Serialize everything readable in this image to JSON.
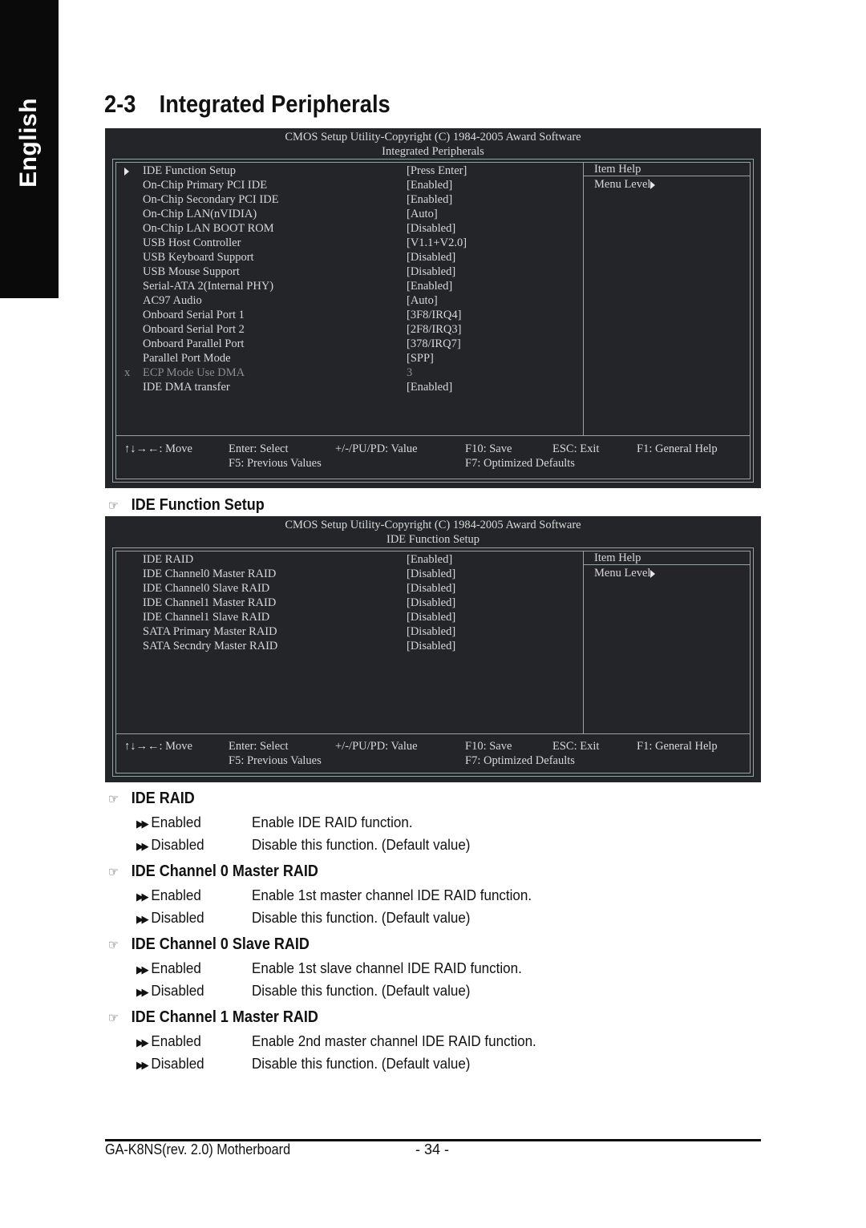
{
  "sidebar_tab": "English",
  "page_title": {
    "number": "2-3",
    "text": "Integrated Peripherals"
  },
  "bios_screens": [
    {
      "header_line1": "CMOS Setup Utility-Copyright (C) 1984-2005 Award Software",
      "header_line2": "Integrated Peripherals",
      "items": [
        {
          "marker": "submenu-arrow",
          "label": "IDE Function Setup",
          "value": "[Press Enter]"
        },
        {
          "marker": "",
          "label": "On-Chip Primary PCI IDE",
          "value": "[Enabled]"
        },
        {
          "marker": "",
          "label": "On-Chip Secondary PCI IDE",
          "value": "[Enabled]"
        },
        {
          "marker": "",
          "label": "On-Chip LAN(nVIDIA)",
          "value": "[Auto]"
        },
        {
          "marker": "",
          "label": "On-Chip LAN BOOT ROM",
          "value": "[Disabled]"
        },
        {
          "marker": "",
          "label": "USB Host Controller",
          "value": "[V1.1+V2.0]"
        },
        {
          "marker": "",
          "label": "USB Keyboard Support",
          "value": "[Disabled]"
        },
        {
          "marker": "",
          "label": "USB Mouse Support",
          "value": "[Disabled]"
        },
        {
          "marker": "",
          "label": "Serial-ATA 2(Internal PHY)",
          "value": "[Enabled]"
        },
        {
          "marker": "",
          "label": "AC97 Audio",
          "value": "[Auto]"
        },
        {
          "marker": "",
          "label": "Onboard Serial Port 1",
          "value": "[3F8/IRQ4]"
        },
        {
          "marker": "",
          "label": "Onboard Serial Port 2",
          "value": "[2F8/IRQ3]"
        },
        {
          "marker": "",
          "label": "Onboard Parallel Port",
          "value": "[378/IRQ7]"
        },
        {
          "marker": "",
          "label": "Parallel Port Mode",
          "value": "[SPP]"
        },
        {
          "marker": "x",
          "label": "ECP Mode Use DMA",
          "value": "3",
          "disabled": true
        },
        {
          "marker": "",
          "label": "IDE DMA transfer",
          "value": "[Enabled]"
        }
      ],
      "help_title": "Item Help",
      "help_menu_level": "Menu Level"
    },
    {
      "header_line1": "CMOS Setup Utility-Copyright (C) 1984-2005 Award Software",
      "header_line2": "IDE Function Setup",
      "items": [
        {
          "marker": "",
          "label": "IDE RAID",
          "value": "[Enabled]"
        },
        {
          "marker": "",
          "label": "IDE Channel0 Master RAID",
          "value": "[Disabled]"
        },
        {
          "marker": "",
          "label": "IDE Channel0 Slave RAID",
          "value": "[Disabled]"
        },
        {
          "marker": "",
          "label": "IDE Channel1 Master RAID",
          "value": "[Disabled]"
        },
        {
          "marker": "",
          "label": "IDE Channel1 Slave RAID",
          "value": "[Disabled]"
        },
        {
          "marker": "",
          "label": "SATA Primary Master RAID",
          "value": "[Disabled]"
        },
        {
          "marker": "",
          "label": "SATA Secndry Master RAID",
          "value": "[Disabled]"
        }
      ],
      "help_title": "Item Help",
      "help_menu_level": "Menu Level"
    }
  ],
  "bios_footer": {
    "move": "↑↓→←: Move",
    "select": "Enter: Select",
    "value": "+/-/PU/PD: Value",
    "save": "F10: Save",
    "exit": "ESC: Exit",
    "help": "F1: General Help",
    "previous": "F5: Previous Values",
    "optimized": "F7: Optimized Defaults"
  },
  "section_ide_function_setup": "IDE Function Setup",
  "sections": [
    {
      "title": "IDE RAID",
      "options": [
        {
          "name": "Enabled",
          "desc": "Enable IDE RAID function."
        },
        {
          "name": "Disabled",
          "desc": "Disable this function. (Default value)"
        }
      ]
    },
    {
      "title": "IDE Channel 0 Master RAID",
      "options": [
        {
          "name": "Enabled",
          "desc": "Enable 1st master channel IDE RAID function."
        },
        {
          "name": "Disabled",
          "desc": "Disable this function. (Default value)"
        }
      ]
    },
    {
      "title": "IDE Channel 0 Slave RAID",
      "options": [
        {
          "name": "Enabled",
          "desc": "Enable 1st slave channel IDE RAID function."
        },
        {
          "name": "Disabled",
          "desc": "Disable this function. (Default value)"
        }
      ]
    },
    {
      "title": "IDE Channel 1 Master RAID",
      "options": [
        {
          "name": "Enabled",
          "desc": "Enable 2nd master channel IDE RAID function."
        },
        {
          "name": "Disabled",
          "desc": "Disable this function. (Default value)"
        }
      ]
    }
  ],
  "footer": {
    "product": "GA-K8NS(rev. 2.0) Motherboard",
    "page": "- 34 -"
  },
  "colors": {
    "bios_bg": "#232528",
    "bios_text": "#d6d9d9",
    "bios_border": "#9aa3a3",
    "disabled_text": "#8a9090",
    "sidebar_bg": "#0a0a0a"
  }
}
